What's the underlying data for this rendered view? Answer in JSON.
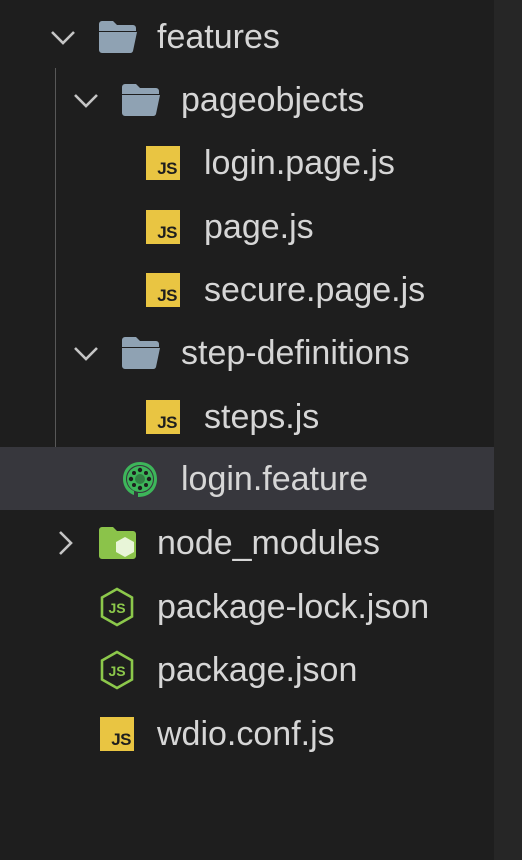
{
  "explorer": {
    "items": [
      {
        "label": "features",
        "icon": "folder-open-icon",
        "chevron": "chevron-down-icon"
      },
      {
        "label": "pageobjects",
        "icon": "folder-open-icon",
        "chevron": "chevron-down-icon"
      },
      {
        "label": "login.page.js",
        "icon": "js-file-icon",
        "badge": "JS"
      },
      {
        "label": "page.js",
        "icon": "js-file-icon",
        "badge": "JS"
      },
      {
        "label": "secure.page.js",
        "icon": "js-file-icon",
        "badge": "JS"
      },
      {
        "label": "step-definitions",
        "icon": "folder-open-icon",
        "chevron": "chevron-down-icon"
      },
      {
        "label": "steps.js",
        "icon": "js-file-icon",
        "badge": "JS"
      },
      {
        "label": "login.feature",
        "icon": "cucumber-icon",
        "selected": true
      },
      {
        "label": "node_modules",
        "icon": "node-folder-icon",
        "chevron": "chevron-right-icon"
      },
      {
        "label": "package-lock.json",
        "icon": "nodejs-icon",
        "badge": "JS"
      },
      {
        "label": "package.json",
        "icon": "nodejs-icon",
        "badge": "JS"
      },
      {
        "label": "wdio.conf.js",
        "icon": "js-file-icon",
        "badge": "JS"
      }
    ]
  },
  "colors": {
    "background": "#1e1e1e",
    "selected_row": "#37373d",
    "js_badge": "#e9c542",
    "folder": "#8fa2b3",
    "node_folder": "#8bc34a",
    "cucumber": "#3db65a",
    "text": "#d6d6d6"
  }
}
